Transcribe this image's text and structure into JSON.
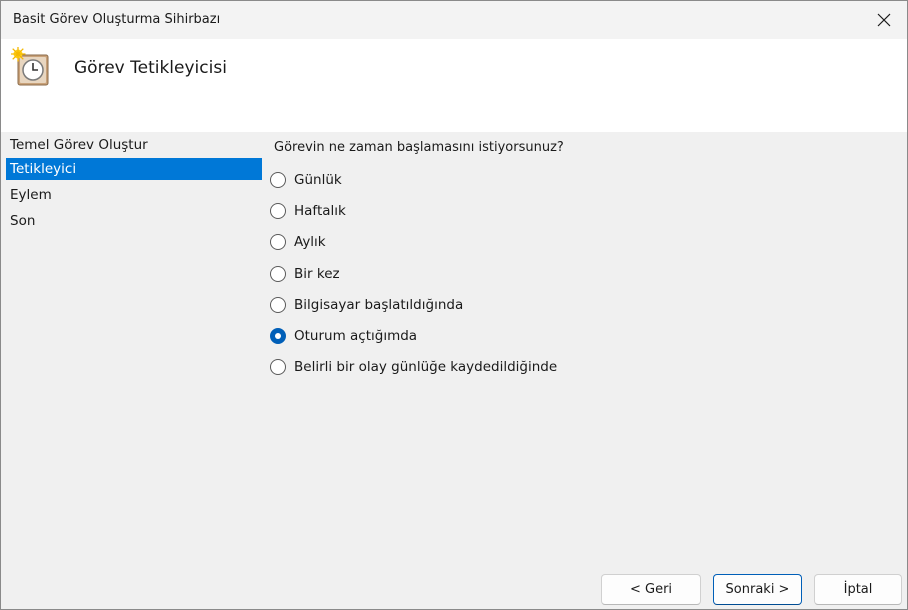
{
  "window": {
    "title": "Basit Görev Oluşturma Sihirbazı"
  },
  "header": {
    "title": "Görev Tetikleyicisi",
    "icon": "scheduled-task-clock-icon"
  },
  "nav": {
    "items": [
      {
        "label": "Temel Görev Oluştur",
        "selected": false
      },
      {
        "label": "Tetikleyici",
        "selected": true
      },
      {
        "label": "Eylem",
        "selected": false
      },
      {
        "label": "Son",
        "selected": false
      }
    ]
  },
  "main": {
    "question": "Görevin ne zaman başlamasını istiyorsunuz?",
    "options": [
      {
        "label": "Günlük",
        "checked": false
      },
      {
        "label": "Haftalık",
        "checked": false
      },
      {
        "label": "Aylık",
        "checked": false
      },
      {
        "label": "Bir kez",
        "checked": false
      },
      {
        "label": "Bilgisayar başlatıldığında",
        "checked": false
      },
      {
        "label": "Oturum açtığımda",
        "checked": true
      },
      {
        "label": "Belirli bir olay günlüğe kaydedildiğinde",
        "checked": false
      }
    ]
  },
  "buttons": {
    "back": "< Geri",
    "next": "Sonraki >",
    "cancel": "İptal"
  },
  "colors": {
    "accent": "#0078d7",
    "radio_checked": "#005fb8",
    "header_bg": "#ffffff",
    "window_bg": "#f0f0f0"
  }
}
